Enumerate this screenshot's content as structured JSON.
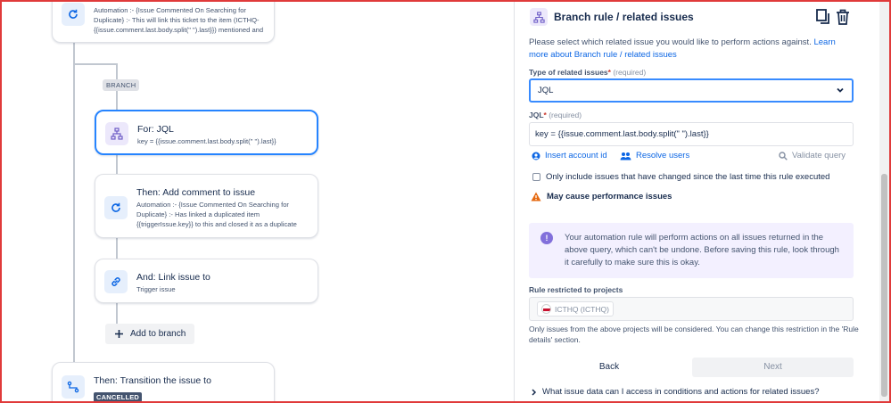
{
  "canvas": {
    "top_card": {
      "line1": "Automation :- {Issue Commented On Searching for",
      "line2": "Duplicate} :- This will link this ticket to the item (ICTHQ-",
      "line3": "{{issue.comment.last.body.split(\" \").last}}) mentioned and"
    },
    "branch_tag": "BRANCH",
    "for_card": {
      "title": "For: JQL",
      "sub": "key = {{issue.comment.last.body.split(\" \").last}}"
    },
    "comment_card": {
      "title": "Then: Add comment to issue",
      "line1": "Automation :- {Issue Commented On Searching for",
      "line2": "Duplicate} :- Has linked a duplicated item",
      "line3": "{{triggerIssue.key}} to this and closed it as a duplicate"
    },
    "link_card": {
      "title": "And: Link issue to",
      "sub": "Trigger issue"
    },
    "add_branch_label": "Add to branch",
    "transition_card": {
      "title": "Then: Transition the issue to",
      "status": "CANCELLED"
    }
  },
  "panel": {
    "title": "Branch rule / related issues",
    "intro": "Please select which related issue you would like to perform actions against.",
    "learn_more_line1": "Learn",
    "learn_more_line2": "more about Branch rule / related issues",
    "type_label": "Type of related issues",
    "required_star": "*",
    "required_text": "(required)",
    "type_value": "JQL",
    "jql_label": "JQL",
    "jql_value": "key =  {{issue.comment.last.body.split(\" \").last}}",
    "insert_account": "Insert account id",
    "resolve_users": "Resolve users",
    "validate_query": "Validate query",
    "only_include": "Only include issues that have changed since the last time this rule executed",
    "warning": "May cause performance issues",
    "notice": "Your automation rule will perform actions on all issues returned in the above query, which can't be undone. Before saving this rule, look through it carefully to make sure this is okay.",
    "restricted_label": "Rule restricted to projects",
    "project_chip": "ICTHQ (ICTHQ)",
    "restriction_note_line1": "Only issues from the above projects will be considered. You can change this restriction in the 'Rule",
    "restriction_note_line2": "details' section.",
    "back": "Back",
    "next": "Next",
    "faq": "What issue data can I access in conditions and actions for related issues?"
  },
  "colors": {
    "accent": "#0c66e4",
    "selected_border": "#2684ff",
    "warning": "#e56910",
    "notice_bg": "#f3f0ff",
    "lozenge": "#44546f"
  }
}
